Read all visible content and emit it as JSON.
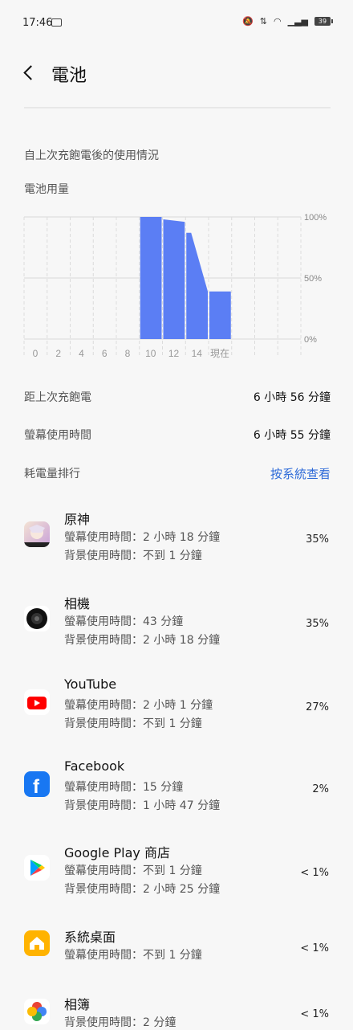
{
  "status": {
    "time": "17:46",
    "battery": "39"
  },
  "header": {
    "title": "電池"
  },
  "section": {
    "since_full": "自上次充飽電後的使用情況",
    "usage_label": "電池用量"
  },
  "chart_data": {
    "type": "area",
    "x_labels": [
      "0",
      "2",
      "4",
      "6",
      "8",
      "10",
      "12",
      "14",
      "現在"
    ],
    "y_labels": [
      "100%",
      "50%",
      "0%"
    ],
    "ylim": [
      0,
      100
    ],
    "grid": true,
    "series": [
      {
        "values": [
          0,
          0,
          0,
          0,
          0,
          100,
          96,
          87,
          39
        ]
      }
    ],
    "color": "#5b7ef4"
  },
  "stats": {
    "since_charge_label": "距上次充飽電",
    "since_charge_value": "6 小時 56 分鐘",
    "screen_label": "螢幕使用時間",
    "screen_value": "6 小時 55 分鐘"
  },
  "ranking": {
    "label": "耗電量排行",
    "link": "按系統查看"
  },
  "apps": [
    {
      "name": "原神",
      "line1": "螢幕使用時間：2 小時 18 分鐘",
      "line2": "背景使用時間：不到 1 分鐘",
      "pct": "35%"
    },
    {
      "name": "相機",
      "line1": "螢幕使用時間：43 分鐘",
      "line2": "背景使用時間：2 小時 18 分鐘",
      "pct": "35%"
    },
    {
      "name": "YouTube",
      "line1": "螢幕使用時間：2 小時 1 分鐘",
      "line2": "背景使用時間：不到 1 分鐘",
      "pct": "27%"
    },
    {
      "name": "Facebook",
      "line1": "螢幕使用時間：15 分鐘",
      "line2": "背景使用時間：1 小時 47 分鐘",
      "pct": "2%"
    },
    {
      "name": "Google Play 商店",
      "line1": "螢幕使用時間：不到 1 分鐘",
      "line2": "背景使用時間：2 小時 25 分鐘",
      "pct": "< 1%"
    },
    {
      "name": "系統桌面",
      "line1": "螢幕使用時間：不到 1 分鐘",
      "pct": "< 1%"
    },
    {
      "name": "相簿",
      "line1": "背景使用時間：2 分鐘",
      "pct": "< 1%"
    }
  ]
}
